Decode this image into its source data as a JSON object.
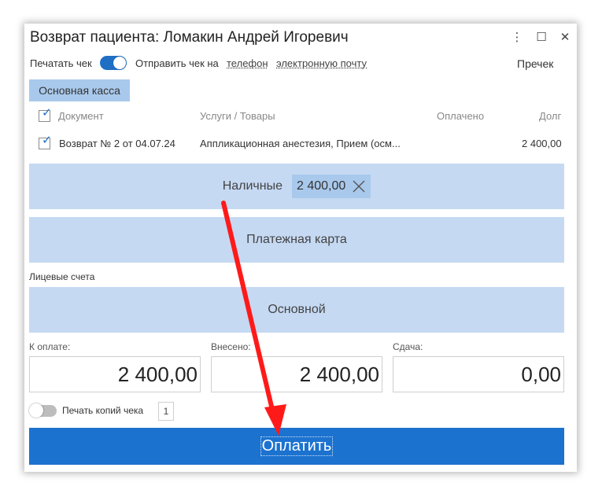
{
  "window": {
    "title": "Возврат пациента: Ломакин Андрей Игоревич",
    "menu_icon": "⋮",
    "maximize_icon": "☐",
    "close_icon": "✕"
  },
  "print_bar": {
    "print_receipt_label": "Печатать чек",
    "print_receipt_on": true,
    "send_receipt_label": "Отправить чек на",
    "phone_link": "телефон",
    "email_link": "электронную почту",
    "precheck_button": "Пречек"
  },
  "cashbox_tab": "Основная касса",
  "table": {
    "columns": [
      "Документ",
      "Услуги / Товары",
      "Оплачено",
      "Долг"
    ],
    "rows": [
      {
        "checked": true,
        "document": "Возврат № 2 от 04.07.24",
        "services": "Аппликационная анестезия, Прием (осм...",
        "paid": "",
        "debt": "2 400,00"
      }
    ]
  },
  "payment_methods": {
    "cash_label": "Наличные",
    "cash_amount": "2 400,00",
    "card_label": "Платежная карта"
  },
  "personal_accounts": {
    "label": "Лицевые счета",
    "main_account": "Основной"
  },
  "totals": {
    "to_pay_label": "К оплате:",
    "to_pay_value": "2 400,00",
    "deposited_label": "Внесено:",
    "deposited_value": "2 400,00",
    "change_label": "Сдача:",
    "change_value": "0,00"
  },
  "copies": {
    "label": "Печать копий чека",
    "value": "1",
    "enabled": false
  },
  "pay_button": "Оплатить",
  "colors": {
    "accent": "#1c72cf",
    "light_block": "#c5d9f2",
    "chip": "#a9c9ec",
    "annotation_arrow": "#ff1a1a"
  }
}
